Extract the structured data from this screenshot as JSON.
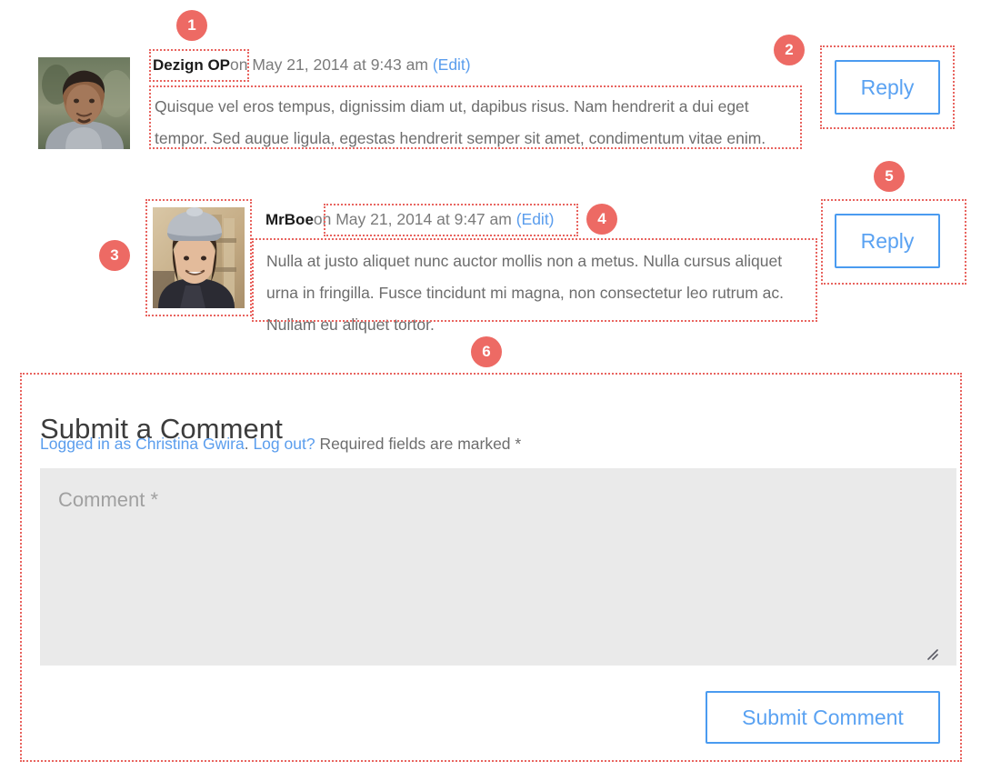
{
  "comments": [
    {
      "author": "Dezign OP",
      "date": "on May 21, 2014 at 9:43 am",
      "edit_label": "(Edit)",
      "body": "Quisque vel eros tempus, dignissim diam ut, dapibus risus. Nam hendrerit a dui eget tempor. Sed augue ligula, egestas hendrerit semper sit amet, condimentum vitae enim.",
      "reply_label": "Reply",
      "avatar_alt": "avatar-dezign-op"
    },
    {
      "author": "MrBoe",
      "date": "on May 21, 2014 at 9:47 am",
      "edit_label": "(Edit)",
      "body": "Nulla at justo aliquet nunc auctor mollis non a metus. Nulla cursus aliquet urna in fringilla. Fusce tincidunt mi magna, non consectetur leo rutrum ac. Nullam eu aliquet tortor.",
      "reply_label": "Reply",
      "avatar_alt": "avatar-mrboe"
    }
  ],
  "submit_form": {
    "title": "Submit a Comment",
    "logged_in_prefix": "Logged in as ",
    "logged_in_user": "Christina Gwira",
    "logged_in_sep": ". ",
    "logout_label": "Log out?",
    "required_note": " Required fields are marked *",
    "comment_placeholder": "Comment *",
    "comment_value": "",
    "submit_label": "Submit Comment"
  },
  "annotations": {
    "badges": [
      {
        "number": "1"
      },
      {
        "number": "2"
      },
      {
        "number": "3"
      },
      {
        "number": "4"
      },
      {
        "number": "5"
      },
      {
        "number": "6"
      }
    ],
    "badge_color": "#ed6a64",
    "outline_color": "#e8645f"
  },
  "theme": {
    "accent_blue": "#4a9bf0",
    "link_blue": "#5a9ded",
    "text_gray": "#6d6d6d",
    "heading_dark": "#3c3c3c",
    "textarea_bg": "#eaeaea"
  }
}
